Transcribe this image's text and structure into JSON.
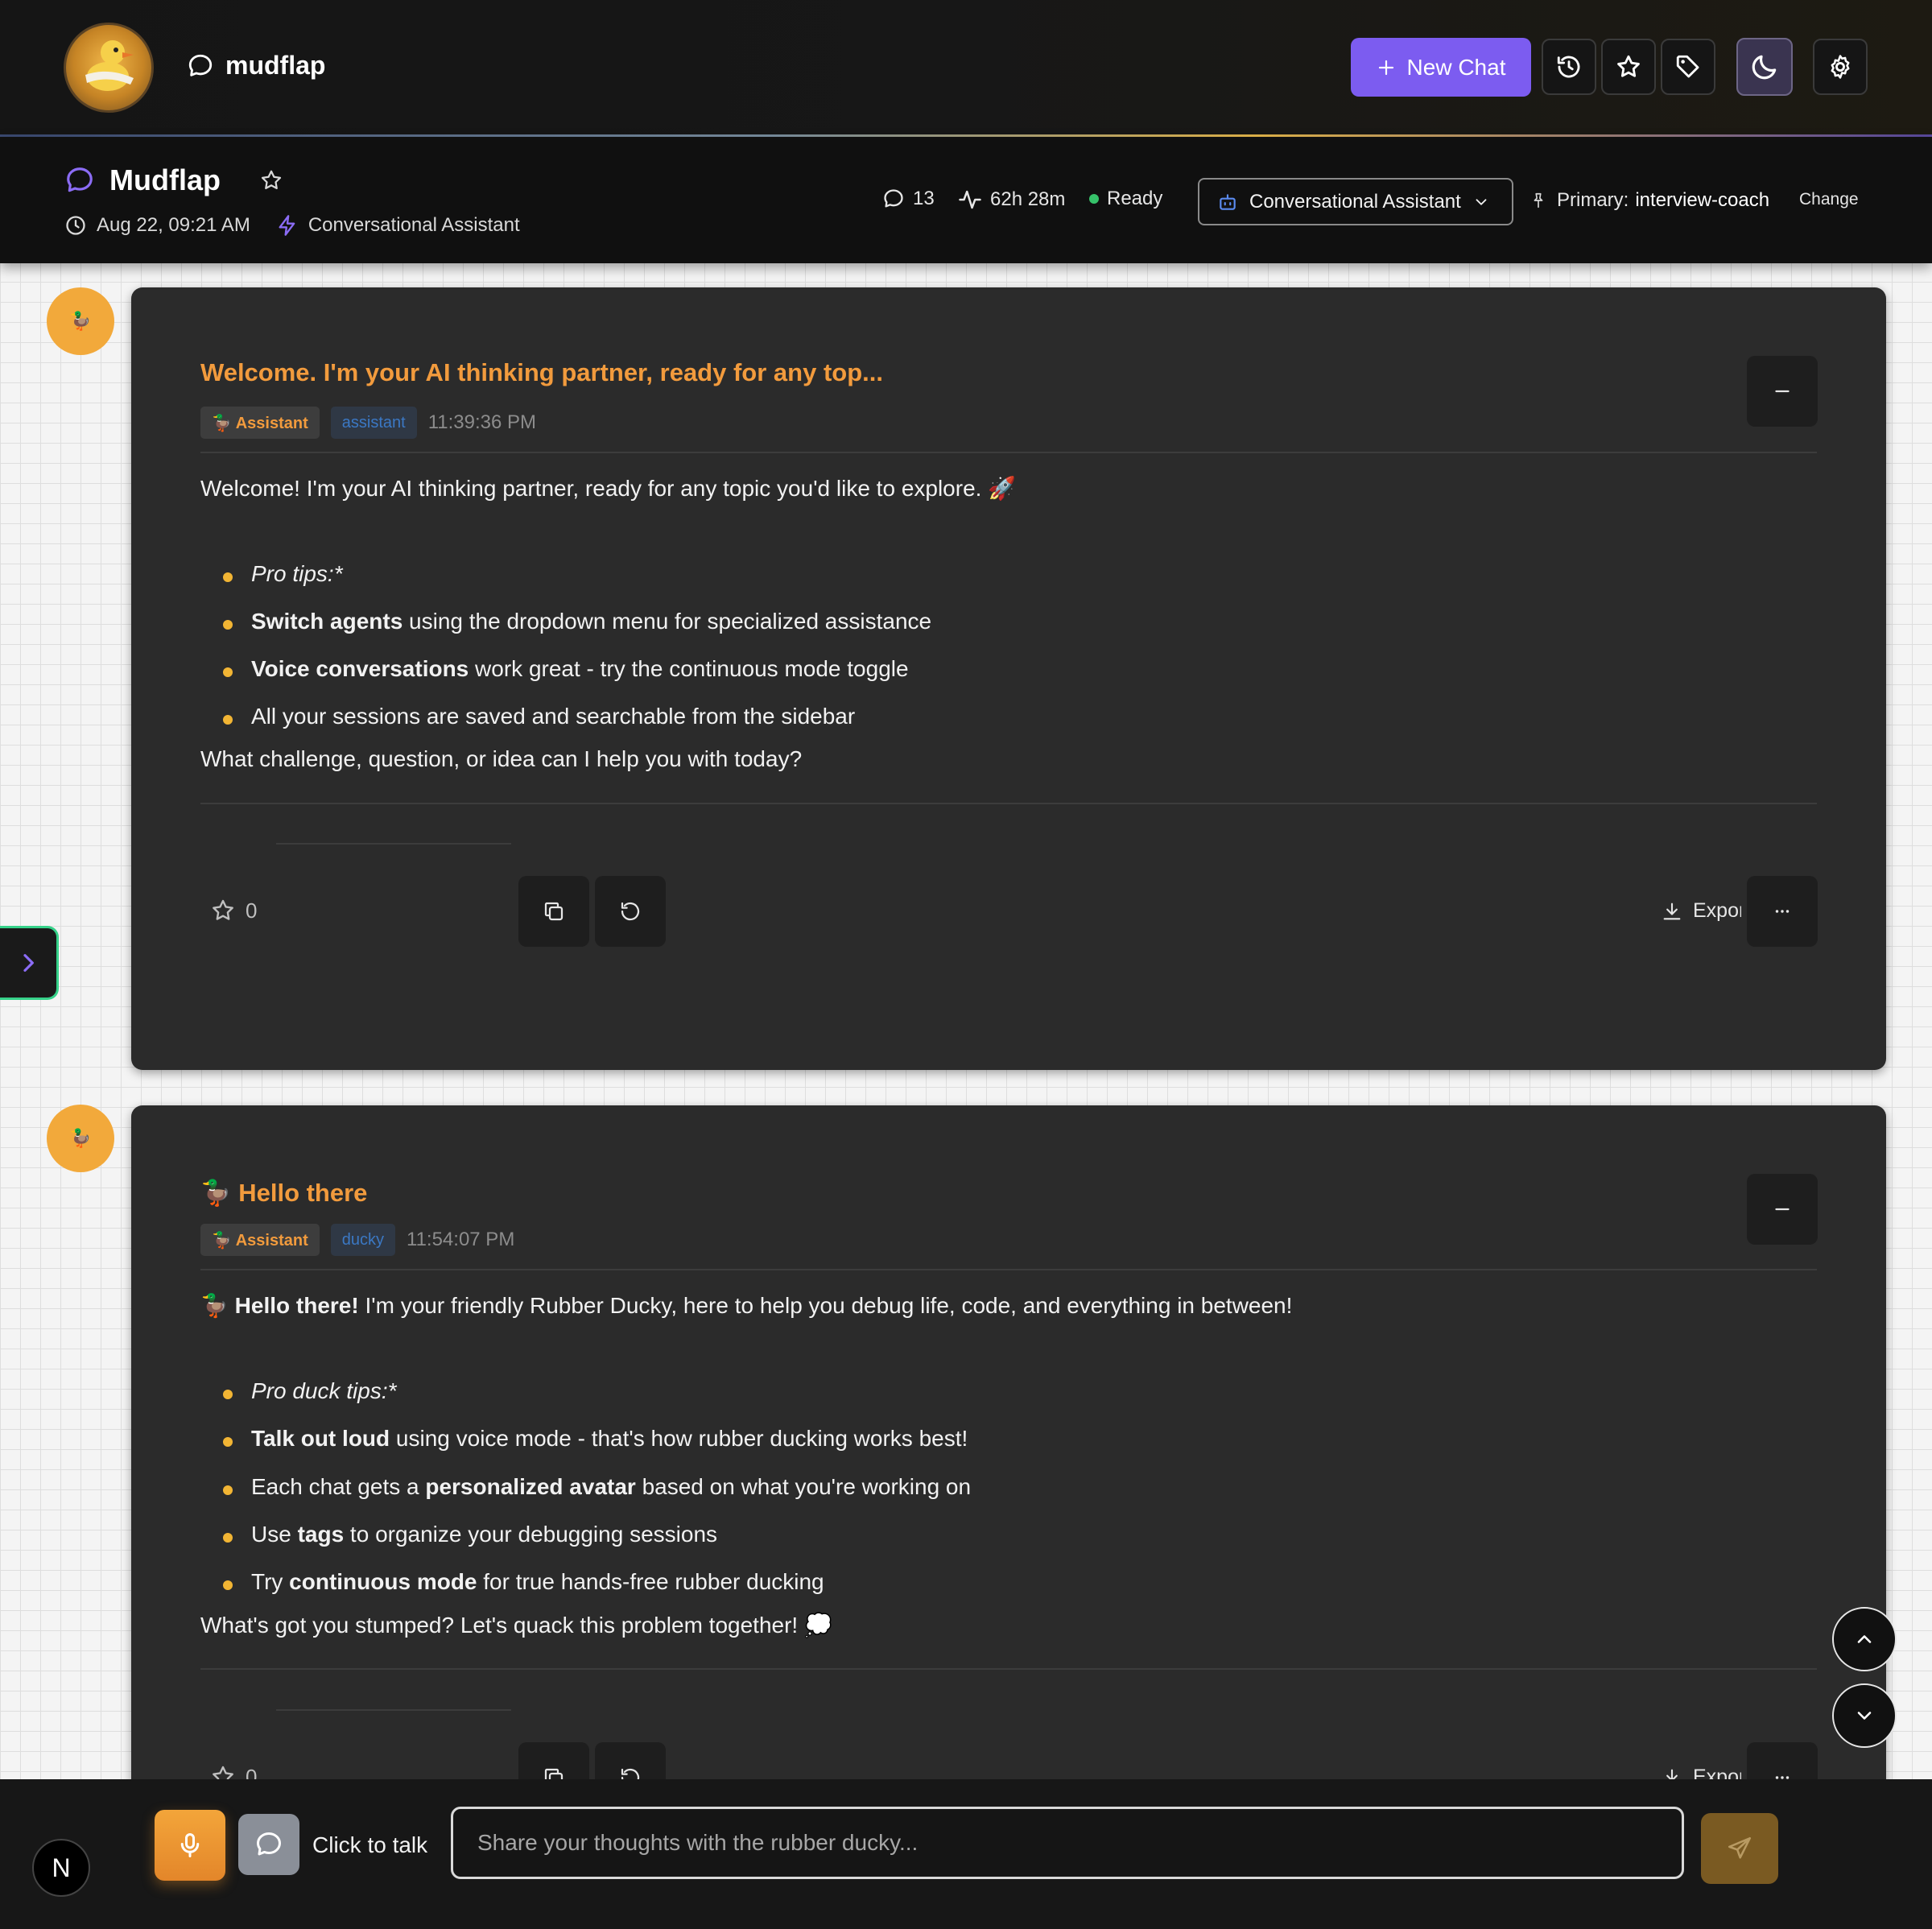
{
  "brand": {
    "name": "mudflap"
  },
  "toolbar": {
    "new_chat_label": "New Chat"
  },
  "session": {
    "title": "Mudflap",
    "date": "Aug 22, 09:21 AM",
    "agent": "Conversational Assistant",
    "message_count": "13",
    "duration": "62h 28m",
    "status": "Ready",
    "agent_select": "Conversational Assistant",
    "primary_label": "Primary:",
    "primary_value": "interview-coach",
    "change_label": "Change"
  },
  "messages": [
    {
      "avatar": "🦆",
      "title": "Welcome. I'm your AI thinking partner, ready for any top...",
      "role": "🦆 Assistant",
      "agent": "assistant",
      "time": "11:39:36 PM",
      "intro": "Welcome! I'm your AI thinking partner, ready for any topic you'd like to explore. 🚀",
      "bullets": [
        {
          "italic": "Pro tips:*"
        },
        {
          "bold": "Switch agents",
          "rest": " using the dropdown menu for specialized assistance"
        },
        {
          "bold": "Voice conversations",
          "rest": " work great - try the continuous mode toggle"
        },
        {
          "rest": "All your sessions are saved and searchable from the sidebar"
        }
      ],
      "closing": "What challenge, question, or idea can I help you with today?",
      "rating": "0",
      "export_label": "Export"
    },
    {
      "avatar": "🦆",
      "title": "🦆 Hello there",
      "role": "🦆 Assistant",
      "agent": "ducky",
      "time": "11:54:07 PM",
      "intro_prefix": "🦆 ",
      "intro_bold": "Hello there!",
      "intro_rest": " I'm your friendly Rubber Ducky, here to help you debug life, code, and everything in between!",
      "bullets": [
        {
          "italic": "Pro duck tips:*"
        },
        {
          "bold": "Talk out loud",
          "rest": " using voice mode - that's how rubber ducking works best!"
        },
        {
          "pre": "Each chat gets a ",
          "bold": "personalized avatar",
          "rest": " based on what you're working on"
        },
        {
          "pre": "Use ",
          "bold": "tags",
          "rest": " to organize your debugging sessions"
        },
        {
          "pre": "Try ",
          "bold": "continuous mode",
          "rest": " for true hands-free rubber ducking"
        }
      ],
      "closing": "What's got you stumped? Let's quack this problem together! 💭",
      "rating": "0",
      "export_label": "Export"
    }
  ],
  "composer": {
    "talk_label": "Click to talk",
    "placeholder": "Share your thoughts with the rubber ducky...",
    "badge": "N"
  },
  "icons": {
    "chat": "chat-bubble-icon",
    "history": "history-icon",
    "star": "star-icon",
    "tag": "tag-icon",
    "theme": "moon-icon",
    "settings": "gear-icon",
    "clock": "clock-icon",
    "bolt": "bolt-icon",
    "activity": "activity-icon",
    "bot": "bot-icon",
    "pin": "pin-icon",
    "copy": "copy-icon",
    "regenerate": "refresh-icon",
    "download": "download-icon",
    "more": "more-icon",
    "mic": "microphone-icon",
    "send": "send-icon"
  },
  "colors": {
    "accent": "#7c5cf0",
    "brand_orange": "#f29b3d",
    "status_ready": "#36c26a",
    "bullet": "#f2b534"
  }
}
